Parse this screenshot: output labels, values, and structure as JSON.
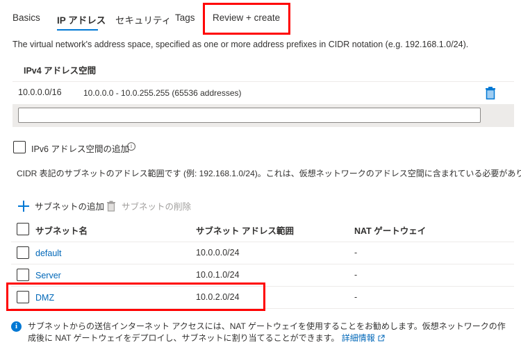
{
  "tabs": [
    {
      "label": "Basics",
      "active": false
    },
    {
      "label": "IP アドレス",
      "active": true
    },
    {
      "label": "セキュリティ",
      "active": false
    },
    {
      "label": "Tags",
      "active": false
    },
    {
      "label": "Review + create",
      "active": false,
      "highlighted": true
    }
  ],
  "address_space": {
    "description": "The virtual network's address space, specified as one or more address prefixes in CIDR notation (e.g. 192.168.1.0/24).",
    "header": "IPv4 アドレス空間",
    "entries": [
      {
        "prefix": "10.0.0.0/16",
        "range": "10.0.0.0 - 10.0.255.255 (65536 addresses)",
        "delete_icon": "trash-icon"
      }
    ],
    "new_input_value": "",
    "new_input_placeholder": ""
  },
  "ipv6": {
    "checkbox_label": "IPv6 アドレス空間の追加",
    "checked": false,
    "info_icon": "info-icon",
    "info_glyph": "i"
  },
  "subnets": {
    "note": "CIDR 表記のサブネットのアドレス範囲です (例: 192.168.1.0/24)。これは、仮想ネットワークのアドレス空間に含まれている必要があります。",
    "commands": {
      "add_label": "サブネットの追加",
      "delete_label": "サブネットの削除",
      "delete_disabled": true
    },
    "columns": [
      "サブネット名",
      "サブネット アドレス範囲",
      "NAT ゲートウェイ"
    ],
    "rows": [
      {
        "name": "default",
        "range": "10.0.0.0/24",
        "nat": "-",
        "highlighted": false
      },
      {
        "name": "Server",
        "range": "10.0.1.0/24",
        "nat": "-",
        "highlighted": false
      },
      {
        "name": "DMZ",
        "range": "10.0.2.0/24",
        "nat": "-",
        "highlighted": true
      }
    ]
  },
  "footer": {
    "info_glyph": "i",
    "message": "サブネットからの送信インターネット アクセスには、NAT ゲートウェイを使用することをお勧めします。仮想ネットワークの作成後に NAT ゲートウェイをデプロイし、サブネットに割り当てることができます。",
    "link_label": "詳細情報"
  },
  "colors": {
    "accent": "#0078d4",
    "link": "#0067b8",
    "highlight": "#ff0000",
    "input_band": "#edebe9",
    "disabled_text": "#a19f9d"
  }
}
